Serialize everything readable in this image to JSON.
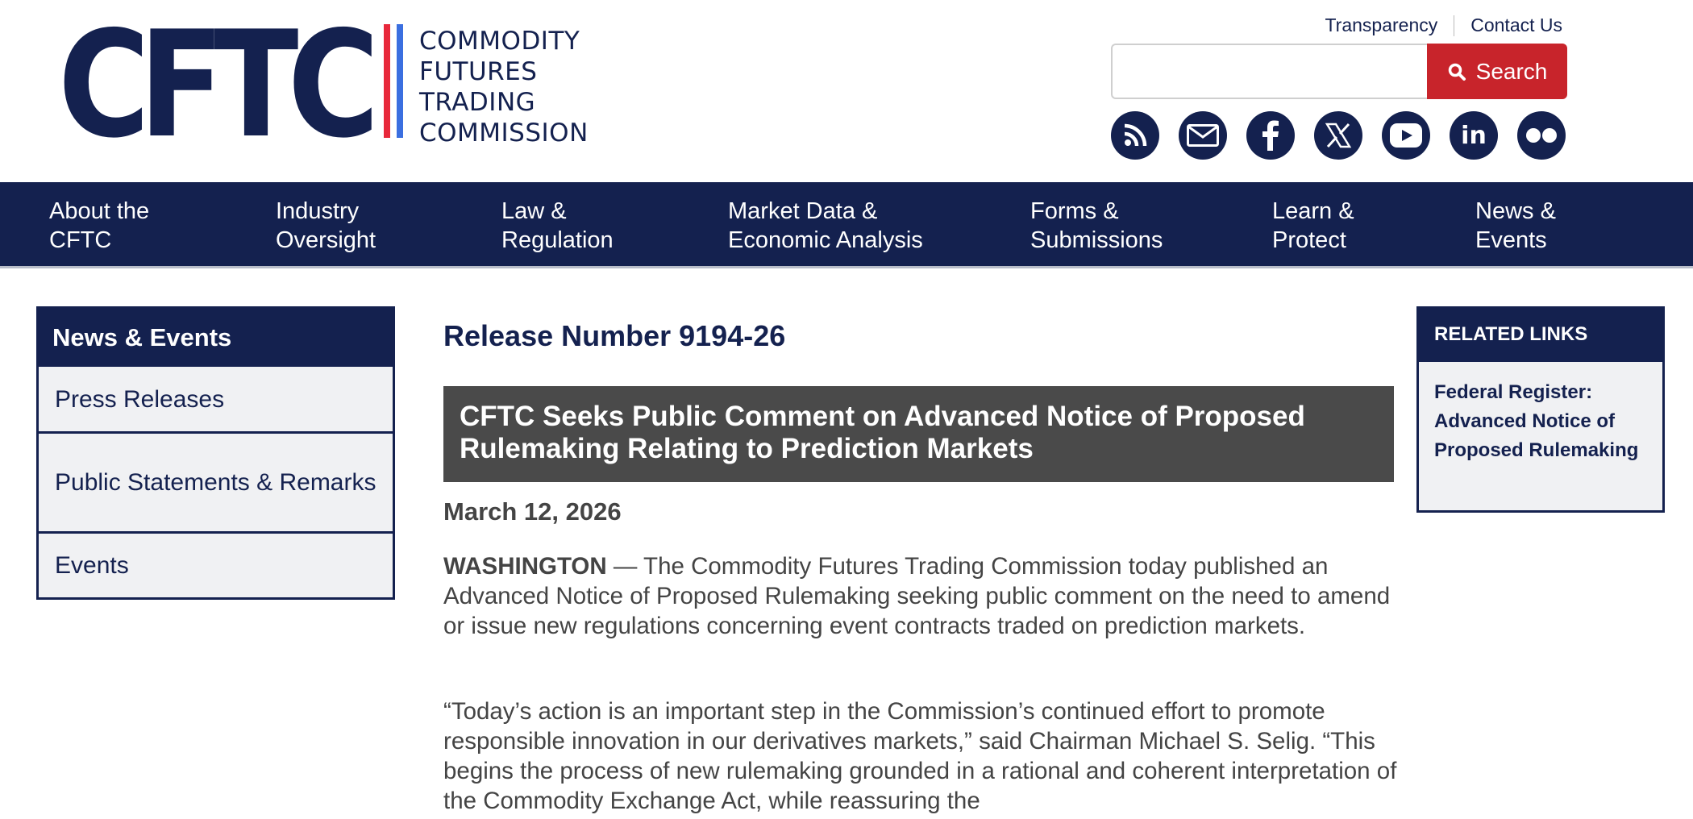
{
  "header": {
    "logo": {
      "mark": "CFTC",
      "words": [
        "COMMODITY",
        "FUTURES",
        "TRADING",
        "COMMISSION"
      ]
    },
    "utility_links": [
      "Transparency",
      "Contact Us"
    ],
    "search": {
      "value": "",
      "placeholder": "",
      "button_label": "Search"
    },
    "social_icons": [
      "rss-icon",
      "email-icon",
      "facebook-icon",
      "x-twitter-icon",
      "youtube-icon",
      "linkedin-icon",
      "flickr-icon"
    ]
  },
  "nav": {
    "items": [
      {
        "line1": "About the",
        "line2": "CFTC"
      },
      {
        "line1": "Industry",
        "line2": "Oversight"
      },
      {
        "line1": "Law &",
        "line2": "Regulation"
      },
      {
        "line1": "Market Data &",
        "line2": "Economic Analysis"
      },
      {
        "line1": "Forms &",
        "line2": "Submissions"
      },
      {
        "line1": "Learn &",
        "line2": "Protect"
      },
      {
        "line1": "News &",
        "line2": "Events"
      }
    ]
  },
  "sidebar": {
    "heading": "News & Events",
    "items": [
      {
        "label": "Press Releases"
      },
      {
        "label": "Public Statements & Remarks"
      },
      {
        "label": "Events"
      }
    ]
  },
  "main": {
    "release_number": "Release Number 9194-26",
    "title": "CFTC Seeks Public Comment on Advanced Notice of Proposed Rulemaking Relating to Prediction Markets",
    "date": "March 12, 2026",
    "dateline": "WASHINGTON",
    "paragraph1": " — The Commodity Futures Trading Commission today published an Advanced Notice of Proposed Rulemaking seeking public comment on the need to amend or issue new regulations concerning event contracts traded on prediction markets.",
    "paragraph2": "“Today’s action is an important step in the Commission’s continued effort to promote responsible innovation in our derivatives markets,” said Chairman Michael S. Selig. “This begins the process of new rulemaking grounded in a rational and coherent interpretation of the Commodity Exchange Act, while reassuring the"
  },
  "related": {
    "heading": "RELATED LINKS",
    "link": "Federal Register: Advanced Notice of Proposed Rulemaking"
  },
  "colors": {
    "navy": "#14214f",
    "red_accent": "#c8242b",
    "title_bg": "#4a4a4a",
    "sidebar_bg": "#f0f1f3"
  }
}
